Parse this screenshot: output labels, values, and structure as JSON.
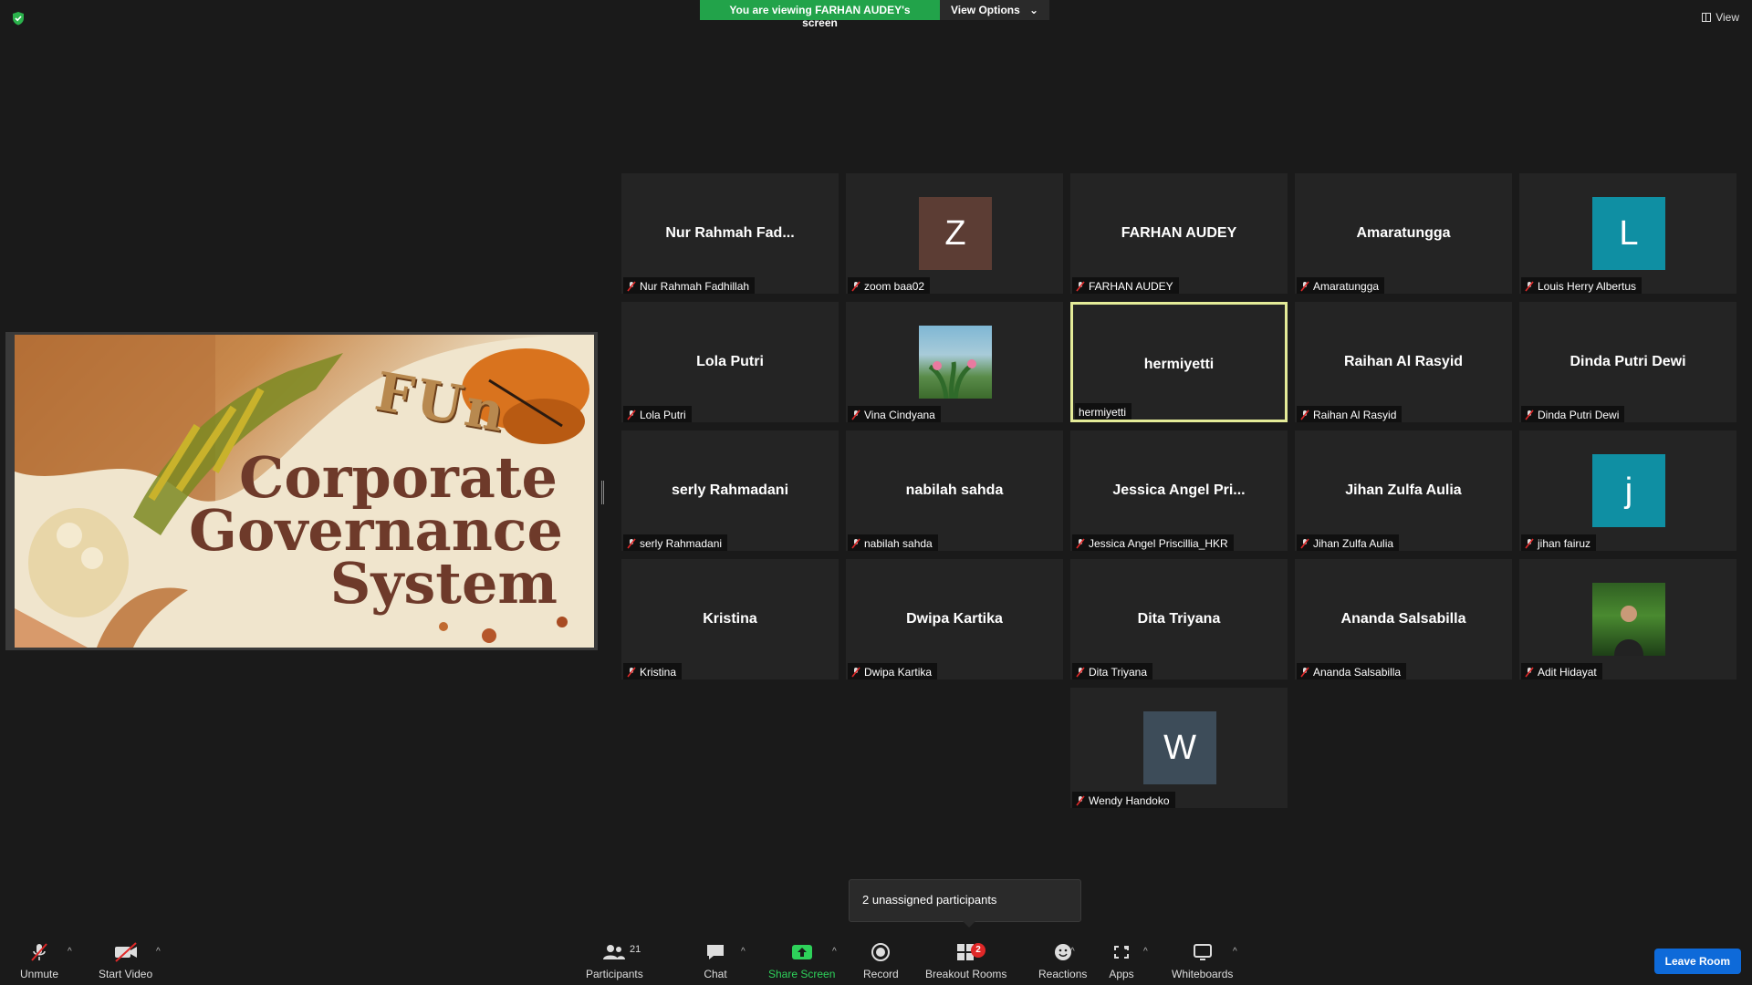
{
  "banner": {
    "viewing_text": "You are viewing FARHAN AUDEY's screen",
    "view_options_label": "View Options"
  },
  "view_button_label": "View",
  "shared_slide": {
    "fun_text": "FUn",
    "title_lines": [
      "Corporate",
      "Governance",
      "System"
    ]
  },
  "tiles": [
    {
      "big": "Nur Rahmah Fad...",
      "label": "Nur Rahmah Fadhillah",
      "muted": true
    },
    {
      "avatar_letter": "Z",
      "avatar_color": "#5c3d34",
      "label": "zoom baa02",
      "muted": true
    },
    {
      "big": "FARHAN AUDEY",
      "label": "FARHAN AUDEY",
      "muted": true
    },
    {
      "big": "Amaratungga",
      "label": "Amaratungga",
      "muted": true
    },
    {
      "avatar_letter": "L",
      "avatar_color": "#0f8fa3",
      "label": "Louis Herry Albertus",
      "muted": true
    },
    {
      "big": "Lola Putri",
      "label": "Lola Putri",
      "muted": true
    },
    {
      "photo": "plant-photo",
      "label": "Vina Cindyana",
      "muted": true
    },
    {
      "big": "hermiyetti",
      "label": "hermiyetti",
      "muted": false,
      "active": true
    },
    {
      "big": "Raihan Al Rasyid",
      "label": "Raihan Al Rasyid",
      "muted": true
    },
    {
      "big": "Dinda Putri Dewi",
      "label": "Dinda Putri Dewi",
      "muted": true
    },
    {
      "big": "serly Rahmadani",
      "label": "serly Rahmadani",
      "muted": true
    },
    {
      "big": "nabilah sahda",
      "label": "nabilah sahda",
      "muted": true
    },
    {
      "big": "Jessica Angel Pri...",
      "label": "Jessica Angel Priscillia_HKR",
      "muted": true
    },
    {
      "big": "Jihan Zulfa Aulia",
      "label": "Jihan Zulfa Aulia",
      "muted": true
    },
    {
      "avatar_letter": "j",
      "avatar_color": "#0f8fa3",
      "label": "jihan fairuz",
      "muted": true
    },
    {
      "big": "Kristina",
      "label": "Kristina",
      "muted": true
    },
    {
      "big": "Dwipa Kartika",
      "label": "Dwipa Kartika",
      "muted": true
    },
    {
      "big": "Dita Triyana",
      "label": "Dita Triyana",
      "muted": true
    },
    {
      "big": "Ananda Salsabilla",
      "label": "Ananda Salsabilla",
      "muted": true
    },
    {
      "photo": "person-photo",
      "label": "Adit Hidayat",
      "muted": true
    },
    {
      "avatar_letter": "W",
      "avatar_color": "#3d4c59",
      "label": "Wendy Handoko",
      "muted": true
    }
  ],
  "tooltip": {
    "text": "2 unassigned participants"
  },
  "toolbar": {
    "unmute": "Unmute",
    "start_video": "Start Video",
    "participants": "Participants",
    "participants_count": "21",
    "chat": "Chat",
    "share_screen": "Share Screen",
    "record": "Record",
    "breakout_rooms": "Breakout Rooms",
    "breakout_badge": "2",
    "reactions": "Reactions",
    "apps": "Apps",
    "whiteboards": "Whiteboards",
    "leave_room": "Leave Room"
  },
  "colors": {
    "banner_green": "#22a34a",
    "active_speaker_border": "#e4eb98",
    "leave_button": "#0e6ad9",
    "share_icon": "#2ed15a",
    "badge_red": "#e02828"
  }
}
